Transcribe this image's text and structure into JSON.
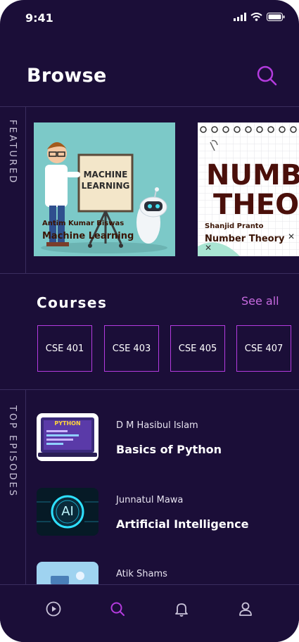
{
  "status_bar": {
    "time": "9:41"
  },
  "header": {
    "title": "Browse"
  },
  "featured": {
    "label": "FEATURED",
    "cards": [
      {
        "board_text": "MACHINE\nLEARNING",
        "author": "Antim Kumar Biswas",
        "title": "Machine Learning"
      },
      {
        "big_text_1": "NUMBE",
        "big_text_2": "THEOR",
        "author": "Shanjid Pranto",
        "title": "Number Theory"
      }
    ]
  },
  "courses": {
    "title": "Courses",
    "see_all": "See all",
    "items": [
      "CSE 401",
      "CSE 403",
      "CSE 405",
      "CSE 407"
    ]
  },
  "top_episodes": {
    "label": "TOP EPISODES",
    "items": [
      {
        "author": "D M Hasibul Islam",
        "title": "Basics of Python",
        "thumb_text": "PYTHON"
      },
      {
        "author": "Junnatul Mawa",
        "title": "Artificial Intelligence",
        "thumb_text": "AI"
      },
      {
        "author": "Atik Shams",
        "title": ""
      }
    ]
  },
  "colors": {
    "background": "#1b0e38",
    "accent": "#b43bdf",
    "divider": "#3a2d5e"
  },
  "tabbar": {
    "icons": [
      "play-icon",
      "search-icon",
      "bell-icon",
      "profile-icon"
    ],
    "active": "search-icon"
  }
}
